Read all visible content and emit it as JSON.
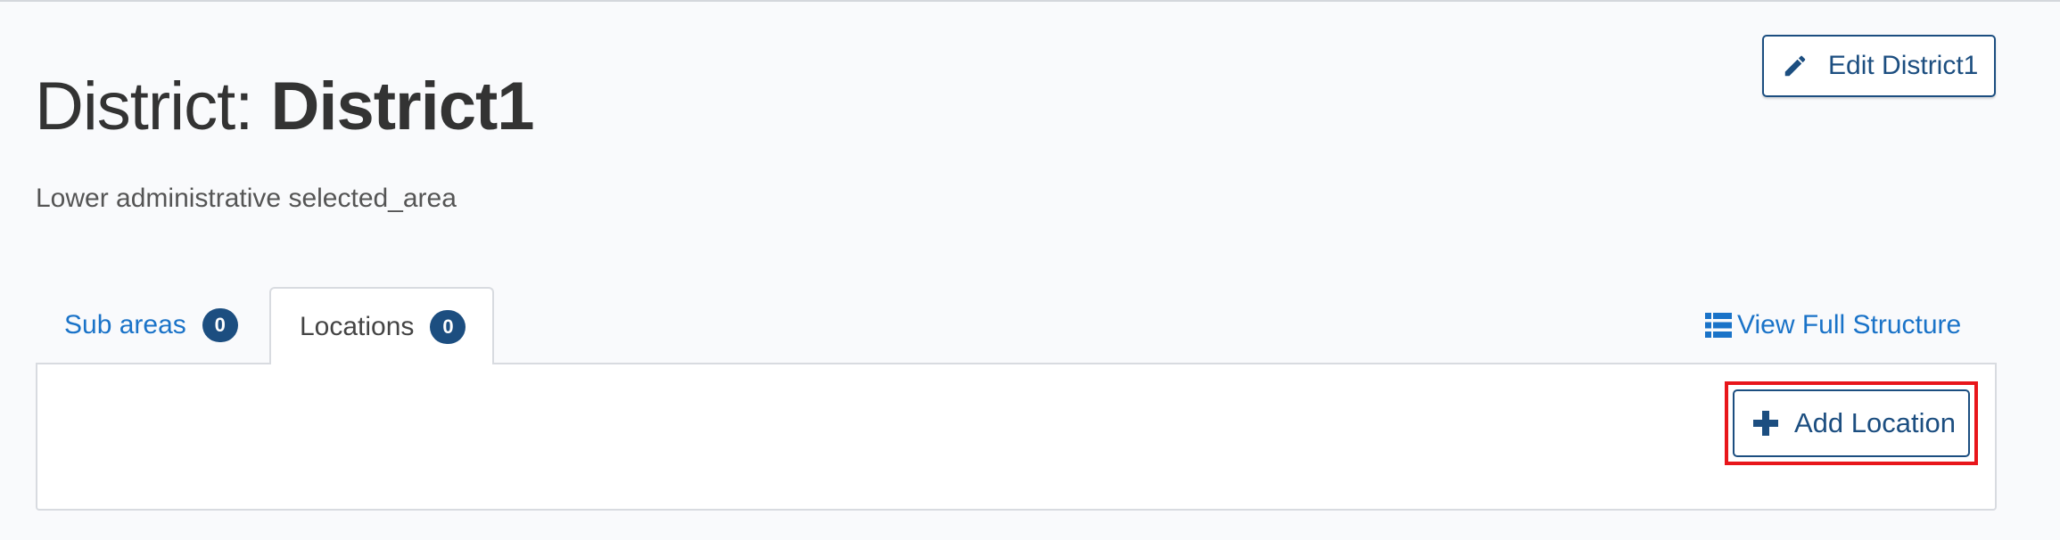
{
  "header": {
    "title_prefix": "District: ",
    "title_name": "District1",
    "subtitle": "Lower administrative selected_area",
    "edit_button_label": "Edit District1"
  },
  "tabs": [
    {
      "label": "Sub areas",
      "count": "0",
      "active": false
    },
    {
      "label": "Locations",
      "count": "0",
      "active": true
    }
  ],
  "view_full_structure_label": "View Full Structure",
  "panel": {
    "add_button_label": "Add Location"
  },
  "icons": {
    "edit": "pencil-icon",
    "structure": "list-icon",
    "add": "plus-icon"
  },
  "colors": {
    "primary": "#1c4e80",
    "link": "#1a73c8",
    "highlight": "#e8161b",
    "background": "#f9fafc"
  }
}
